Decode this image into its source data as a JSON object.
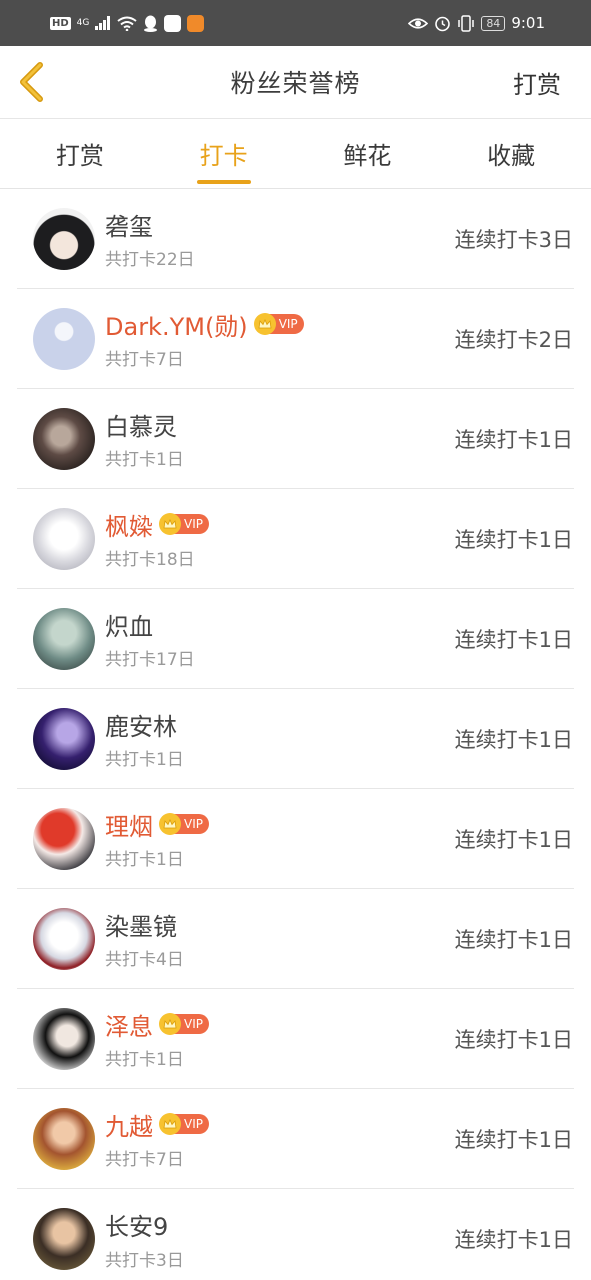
{
  "status_bar": {
    "network_hd": "HD",
    "network_gen": "4G",
    "battery": "84",
    "time": "9:01"
  },
  "header": {
    "title": "粉丝荣誉榜",
    "action": "打赏"
  },
  "tabs": [
    {
      "label": "打赏",
      "active": false
    },
    {
      "label": "打卡",
      "active": true
    },
    {
      "label": "鲜花",
      "active": false
    },
    {
      "label": "收藏",
      "active": false
    }
  ],
  "vip_label": "VIP",
  "colors": {
    "accent": "#e8a21a",
    "vip_name": "#e15a34",
    "vip_badge": "#ef6a45",
    "crown": "#f7c22f"
  },
  "fans": [
    {
      "name": "砻玺",
      "total": "共打卡22日",
      "streak": "连续打卡3日",
      "vip": false
    },
    {
      "name": "Dark.YM(勋)",
      "total": "共打卡7日",
      "streak": "连续打卡2日",
      "vip": true
    },
    {
      "name": "白慕灵",
      "total": "共打卡1日",
      "streak": "连续打卡1日",
      "vip": false
    },
    {
      "name": "枫媣",
      "total": "共打卡18日",
      "streak": "连续打卡1日",
      "vip": true
    },
    {
      "name": "炽血",
      "total": "共打卡17日",
      "streak": "连续打卡1日",
      "vip": false
    },
    {
      "name": "鹿安林",
      "total": "共打卡1日",
      "streak": "连续打卡1日",
      "vip": false
    },
    {
      "name": "理烟",
      "total": "共打卡1日",
      "streak": "连续打卡1日",
      "vip": true
    },
    {
      "name": "染墨镜",
      "total": "共打卡4日",
      "streak": "连续打卡1日",
      "vip": false
    },
    {
      "name": "泽息",
      "total": "共打卡1日",
      "streak": "连续打卡1日",
      "vip": true
    },
    {
      "name": "九越",
      "total": "共打卡7日",
      "streak": "连续打卡1日",
      "vip": true
    },
    {
      "name": "长安9",
      "total": "共打卡3日",
      "streak": "连续打卡1日",
      "vip": false
    }
  ]
}
